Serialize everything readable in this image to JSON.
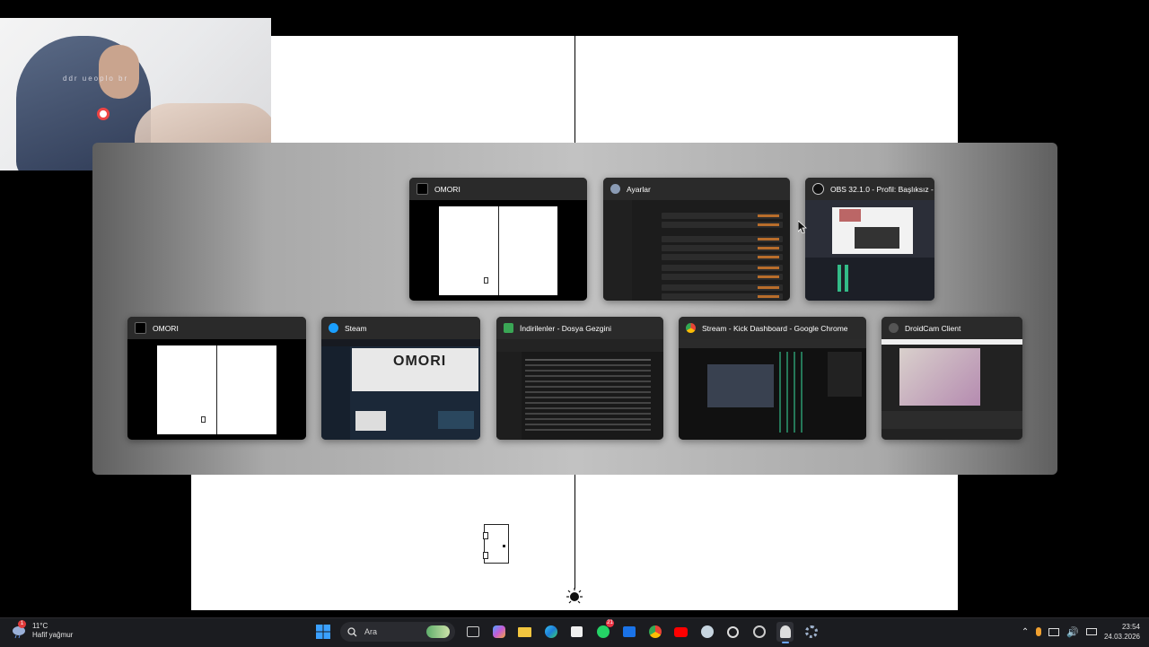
{
  "webcam": {
    "overlay_text": "ddr ueoplo br"
  },
  "switcher": {
    "windows": [
      {
        "title": "OMORI",
        "icon": "omori-icon"
      },
      {
        "title": "Ayarlar",
        "icon": "settings-gear-icon"
      },
      {
        "title": "OBS 32.1.0 - Profil: Başlıksız - ...",
        "icon": "obs-icon"
      },
      {
        "title": "OMORI",
        "icon": "omori-icon"
      },
      {
        "title": "Steam",
        "icon": "steam-icon"
      },
      {
        "title": "İndirilenler - Dosya Gezgini",
        "icon": "download-icon"
      },
      {
        "title": "Stream - Kick Dashboard - Google Chrome",
        "icon": "chrome-icon"
      },
      {
        "title": "DroidCam Client",
        "icon": "droidcam-icon"
      }
    ],
    "steam_thumb_text": "OMORI"
  },
  "taskbar": {
    "weather": {
      "temp": "11°C",
      "condition": "Hafif yağmur",
      "badge": "1"
    },
    "search_label": "Ara",
    "whatsapp_badge": "21",
    "clock": {
      "time": "23:54",
      "date": "24.03.2026"
    }
  },
  "colors": {
    "accent": "#6ba5ff",
    "taskbar": "#1b1c20",
    "settings_toggle": "#b86d2b"
  }
}
